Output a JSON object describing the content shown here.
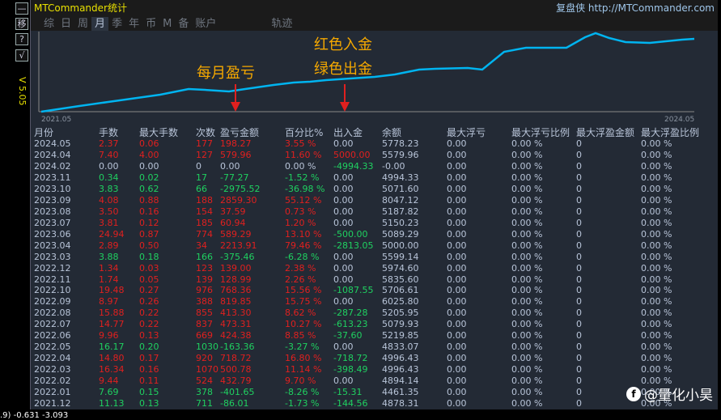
{
  "app": {
    "title": "MTCommander统计",
    "brand": "复盘侠 http://MTCommander.com",
    "version": "V 5.05",
    "status": ".9) -0.631 -3.093"
  },
  "side_buttons": [
    "—",
    "移",
    "?",
    "√"
  ],
  "tabs": [
    {
      "label": "综"
    },
    {
      "label": "日"
    },
    {
      "label": "周"
    },
    {
      "label": "月",
      "active": true
    },
    {
      "label": "季"
    },
    {
      "label": "年"
    },
    {
      "label": "币"
    },
    {
      "label": "M"
    },
    {
      "label": "备"
    },
    {
      "label": "账户"
    },
    {
      "label": "轨迹"
    }
  ],
  "chart": {
    "x_start": "2021.05",
    "x_end": "2024.05",
    "line_color": "#00b4f0"
  },
  "annotations": {
    "monthly": "每月盈亏",
    "red": "红色入金",
    "green": "绿色出金"
  },
  "columns": [
    "月份",
    "手数",
    "最大手数",
    "次数",
    "盈亏金额",
    "百分比%",
    "出入金",
    "余额",
    "最大浮亏",
    "最大浮亏比例",
    "最大浮盈金额",
    "最大浮盈比例"
  ],
  "rows": [
    [
      "2024.05",
      "2.37",
      "0.06",
      "177",
      "198.27",
      "3.55 %",
      "0.00",
      "5778.23",
      "r",
      "n"
    ],
    [
      "2024.04",
      "7.40",
      "4.00",
      "127",
      "579.96",
      "11.60 %",
      "5000.00",
      "5579.96",
      "r",
      "r"
    ],
    [
      "2024.02",
      "0.00",
      "0.00",
      "0",
      "0.00",
      "0.00 %",
      "-4994.33",
      "-0.00",
      "n",
      "g"
    ],
    [
      "2023.11",
      "0.34",
      "0.02",
      "17",
      "-77.27",
      "-1.52 %",
      "0.00",
      "4994.33",
      "g",
      "n"
    ],
    [
      "2023.10",
      "3.83",
      "0.62",
      "66",
      "-2975.52",
      "-36.98 %",
      "0.00",
      "5071.60",
      "g",
      "n"
    ],
    [
      "2023.09",
      "4.08",
      "0.88",
      "188",
      "2859.30",
      "55.12 %",
      "0.00",
      "8047.12",
      "r",
      "n"
    ],
    [
      "2023.08",
      "3.50",
      "0.16",
      "154",
      "37.59",
      "0.73 %",
      "0.00",
      "5187.82",
      "r",
      "n"
    ],
    [
      "2023.07",
      "3.81",
      "0.12",
      "185",
      "60.94",
      "1.20 %",
      "0.00",
      "5150.23",
      "r",
      "n"
    ],
    [
      "2023.06",
      "24.94",
      "0.87",
      "774",
      "589.29",
      "13.10 %",
      "-500.00",
      "5089.29",
      "r",
      "g"
    ],
    [
      "2023.04",
      "2.89",
      "0.50",
      "34",
      "2213.91",
      "79.46 %",
      "-2813.05",
      "5000.00",
      "r",
      "g"
    ],
    [
      "2023.03",
      "3.88",
      "0.18",
      "166",
      "-375.46",
      "-6.28 %",
      "0.00",
      "5599.14",
      "g",
      "n"
    ],
    [
      "2022.12",
      "1.34",
      "0.03",
      "123",
      "139.00",
      "2.38 %",
      "0.00",
      "5974.60",
      "r",
      "n"
    ],
    [
      "2022.11",
      "1.74",
      "0.05",
      "139",
      "128.99",
      "2.26 %",
      "0.00",
      "5835.60",
      "r",
      "n"
    ],
    [
      "2022.10",
      "19.48",
      "0.27",
      "976",
      "768.36",
      "15.56 %",
      "-1087.55",
      "5706.61",
      "r",
      "g"
    ],
    [
      "2022.09",
      "8.97",
      "0.26",
      "388",
      "819.85",
      "15.75 %",
      "0.00",
      "6025.80",
      "r",
      "n"
    ],
    [
      "2022.08",
      "15.88",
      "0.22",
      "855",
      "413.30",
      "8.62 %",
      "-287.28",
      "5205.95",
      "r",
      "g"
    ],
    [
      "2022.07",
      "14.77",
      "0.22",
      "837",
      "473.31",
      "10.27 %",
      "-613.23",
      "5079.93",
      "r",
      "g"
    ],
    [
      "2022.06",
      "9.96",
      "0.13",
      "669",
      "424.38",
      "8.85 %",
      "-37.60",
      "5219.85",
      "r",
      "g"
    ],
    [
      "2022.05",
      "16.17",
      "0.20",
      "1030",
      "-163.36",
      "-3.27 %",
      "0.00",
      "4833.07",
      "g",
      "n"
    ],
    [
      "2022.04",
      "14.80",
      "0.17",
      "920",
      "718.72",
      "16.80 %",
      "-718.72",
      "4996.43",
      "r",
      "g"
    ],
    [
      "2022.03",
      "16.34",
      "0.16",
      "1070",
      "500.78",
      "11.14 %",
      "-398.49",
      "4996.43",
      "r",
      "g"
    ],
    [
      "2022.02",
      "9.44",
      "0.11",
      "524",
      "432.79",
      "9.70 %",
      "0.00",
      "4894.14",
      "r",
      "n"
    ],
    [
      "2022.01",
      "7.69",
      "0.15",
      "378",
      "-401.65",
      "-8.26 %",
      "-15.31",
      "4461.35",
      "g",
      "g"
    ],
    [
      "2021.12",
      "11.13",
      "0.13",
      "711",
      "-86.01",
      "-1.73 %",
      "-144.56",
      "4878.31",
      "g",
      "g"
    ]
  ],
  "float_values": {
    "max_float_loss": "0.00",
    "max_float_loss_pct": "0.00 %",
    "max_float_profit": "0",
    "max_float_profit_pct": "0.00 %"
  },
  "watermark": {
    "icon": "f",
    "text": "@量化小昊"
  }
}
